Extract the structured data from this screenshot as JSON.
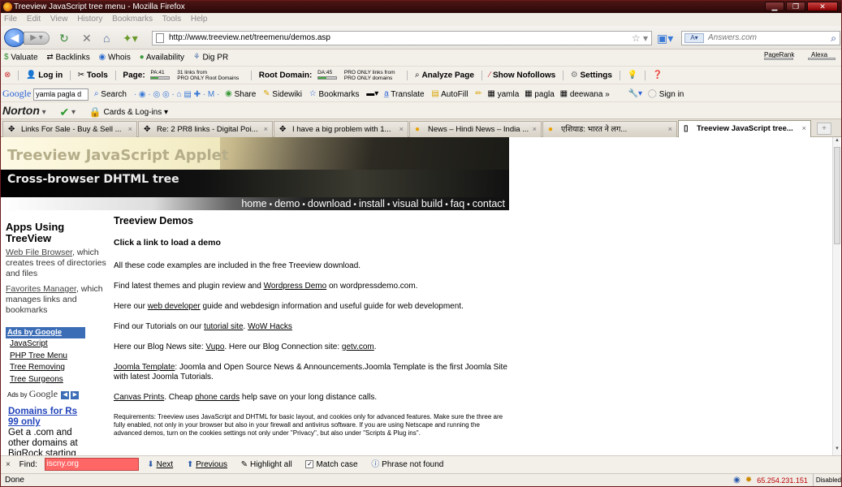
{
  "window": {
    "title": "Treeview JavaScript tree menu - Mozilla Firefox"
  },
  "menu": [
    "File",
    "Edit",
    "View",
    "History",
    "Bookmarks",
    "Tools",
    "Help"
  ],
  "nav": {
    "url": "http://www.treeview.net/treemenu/demos.asp",
    "search_placeholder": "Answers.com"
  },
  "toolbar1": {
    "valuate": "Valuate",
    "backlinks": "Backlinks",
    "whois": "Whois",
    "availability": "Availability",
    "digpr": "Dig PR",
    "pagerank": "PageRank",
    "alexa": "Alexa"
  },
  "toolbar2": {
    "login": "Log in",
    "tools": "Tools",
    "page": "Page:",
    "pa": "PA:41",
    "pa_links": "31 links from",
    "pa_domains": "PRO ONLY Root Domains",
    "root_domain": "Root Domain:",
    "da": "DA:45",
    "da_links": "PRO ONLY links from",
    "da_domains": "PRO ONLY domains",
    "analyze": "Analyze Page",
    "nofollows": "Show Nofollows",
    "settings": "Settings"
  },
  "toolbar3": {
    "google_query": "yamla pagla d",
    "search": "Search",
    "share": "Share",
    "sidewiki": "Sidewiki",
    "bookmarks": "Bookmarks",
    "translate": "Translate",
    "autofill": "AutoFill",
    "yamla": "yamla",
    "pagla": "pagla",
    "deewana": "deewana",
    "more": "»",
    "signin": "Sign in"
  },
  "toolbar4": {
    "norton": "Norton",
    "cards": "Cards & Log-ins"
  },
  "tabs": [
    {
      "label": "Links For Sale - Buy & Sell ..."
    },
    {
      "label": "Re: 2 PR8 links - Digital Poi..."
    },
    {
      "label": "I have a big problem with 1..."
    },
    {
      "label": "News – Hindi News – India ..."
    },
    {
      "label": "एशियाड: भारत ने लग..."
    },
    {
      "label": "Treeview JavaScript tree..."
    }
  ],
  "site": {
    "title": "Treeview JavaScript Applet",
    "subtitle": "Cross-browser DHTML tree",
    "nav": [
      "home",
      "demo",
      "download",
      "install",
      "visual build",
      "faq",
      "contact"
    ]
  },
  "sidebar": {
    "heading": "Apps Using TreeView",
    "item1_link": "Web File Browser",
    "item1_text": ", which creates trees of directories and files",
    "item2_link": "Favorites Manager",
    "item2_text": ", which manages links and bookmarks",
    "ads_header": "Ads by Google",
    "ads": [
      "JavaScript",
      "PHP Tree Menu",
      "Tree Removing",
      "Tree Surgeons"
    ],
    "ads_by": "Ads by",
    "google": "Google",
    "promo_head": "Domains for Rs 99 only",
    "promo_text": "Get a .com and other domains at BigRock starting"
  },
  "main": {
    "heading": "Treeview Demos",
    "subheading": "Click a link to load a demo",
    "p1": "All these code examples are included in the free Treeview download.",
    "p2a": "Find latest themes and plugin review and ",
    "p2link": "Wordpress Demo",
    "p2b": " on wordpressdemo.com.",
    "p3a": "Here our ",
    "p3link": "web developer",
    "p3b": " guide and webdesign information and useful guide for web development.",
    "p4a": "Find our Tutorials on our ",
    "p4link1": "tutorial site",
    "p4sep": ". ",
    "p4link2": "WoW Hacks",
    "p5a": "Here our Blog News site: ",
    "p5link1": "Vupo",
    "p5b": ". Here our Blog Connection site: ",
    "p5link2": "getv.com",
    "p5c": ".",
    "p6link": "Joomla Template",
    "p6text": ": Joomla and Open Source News & Announcements.Joomla Template is the first Joomla Site with latest Joomla Tutorials.",
    "p7link1": "Canvas Prints",
    "p7a": ". Cheap ",
    "p7link2": "phone cards",
    "p7b": " help save on your long distance calls.",
    "req": "Requirements: Treeview uses JavaScript and DHTML for basic layout, and cookies only for advanced features. Make sure the three are fully enabled, not only in your browser but also in your firewall and antivirus software. If you are using Netscape and running the advanced demos, turn on the cookies settings not only under \"Privacy\", but also under \"Scripts & Plug ins\"."
  },
  "findbar": {
    "close": "×",
    "label": "Find:",
    "query": "iscny.org",
    "next": "Next",
    "previous": "Previous",
    "highlight": "Highlight all",
    "matchcase": "Match case",
    "status": "Phrase not found"
  },
  "statusbar": {
    "text": "Done",
    "ip": "65.254.231.151",
    "disabled": "Disabled"
  }
}
